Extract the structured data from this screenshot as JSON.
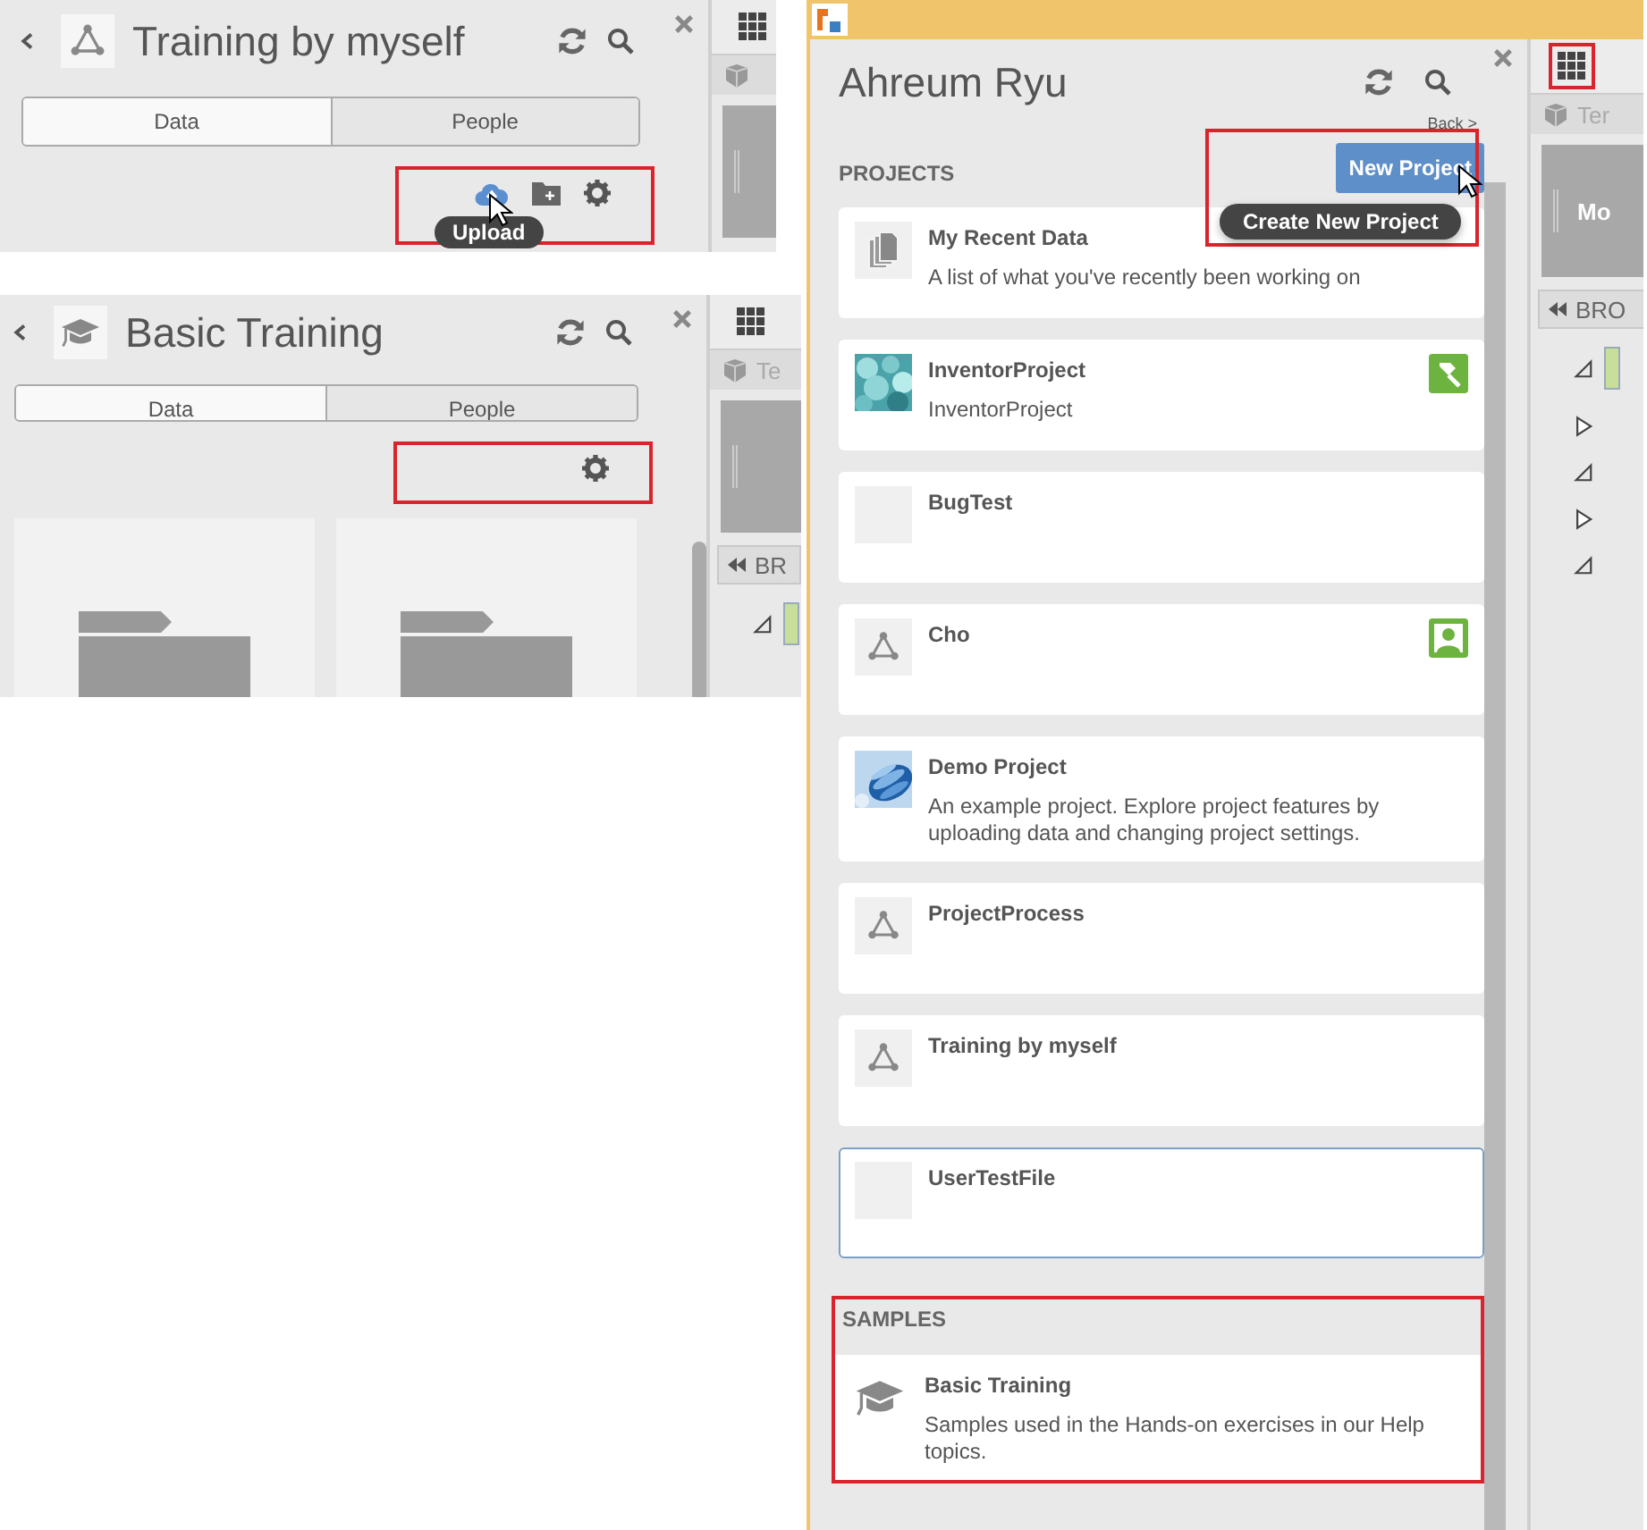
{
  "screens": [
    {
      "kind": "project",
      "header": {
        "kind": "network",
        "title": "Training by myself"
      },
      "tabs": [
        {
          "label": "Data",
          "selected": true
        },
        {
          "label": "People",
          "selected": false
        }
      ],
      "toolbar": {
        "highlighted": true,
        "tools": [
          {
            "kind": "upload",
            "cursor": true
          },
          {
            "kind": "new-folder",
            "cursor": false
          },
          {
            "kind": "settings",
            "cursor": false
          }
        ],
        "tooltip": "Upload"
      },
      "folder_tiles": false,
      "side": {
        "grid_highlighted": false
      }
    },
    {
      "kind": "project",
      "header": {
        "kind": "cap",
        "title": "Basic Training"
      },
      "tabs": [
        {
          "label": "Data",
          "selected": true
        },
        {
          "label": "People",
          "selected": false
        }
      ],
      "toolbar": {
        "highlighted": true,
        "tools": [
          {
            "kind": "settings",
            "cursor": false
          }
        ]
      },
      "folder_tiles": true,
      "side": {
        "grid_highlighted": false,
        "cube_label": "Te",
        "bar_label": "BR",
        "tree": [
          {
            "expanded": true,
            "swatch": true
          }
        ]
      }
    },
    {
      "kind": "hub",
      "title": "Ahreum Ryu",
      "back": "Back >",
      "projects_label": "PROJECTS",
      "new_button": "New Project",
      "new_tooltip": "Create New Project",
      "new_highlighted": true,
      "new_cursor": true,
      "projects": [
        {
          "name": "My Recent Data",
          "description": "A list of what you've recently been working on",
          "kind": "documents",
          "selected": false
        },
        {
          "name": "InventorProject",
          "description": "InventorProject",
          "kind": "teal-picture",
          "badge": {
            "kind": "hammer"
          },
          "selected": false
        },
        {
          "name": "BugTest",
          "kind": "blank",
          "selected": false
        },
        {
          "name": "Cho",
          "kind": "network",
          "badge": {
            "kind": "person"
          },
          "selected": false
        },
        {
          "name": "Demo Project",
          "description": "An example project. Explore project features by uploading data and changing project settings.",
          "kind": "blue-picture",
          "selected": false
        },
        {
          "name": "ProjectProcess",
          "kind": "network",
          "selected": false
        },
        {
          "name": "Training by myself",
          "kind": "network",
          "selected": false
        },
        {
          "name": "UserTestFile",
          "kind": "blank",
          "selected": true
        }
      ],
      "samples": {
        "label": "SAMPLES",
        "highlighted": true,
        "items": [
          {
            "name": "Basic Training",
            "description": "Samples used in the Hands-on exercises in our Help topics.",
            "kind": "cap"
          }
        ]
      },
      "side": {
        "grid_highlighted": true,
        "cube_label": "Ter",
        "block_label": "Mo",
        "bar_label": "BRO",
        "tree": [
          {
            "expanded": true,
            "swatch": true
          },
          {
            "expanded": false,
            "swatch": false
          },
          {
            "expanded": true,
            "swatch": false
          },
          {
            "expanded": false,
            "swatch": false
          },
          {
            "expanded": true,
            "swatch": false
          }
        ]
      }
    }
  ]
}
